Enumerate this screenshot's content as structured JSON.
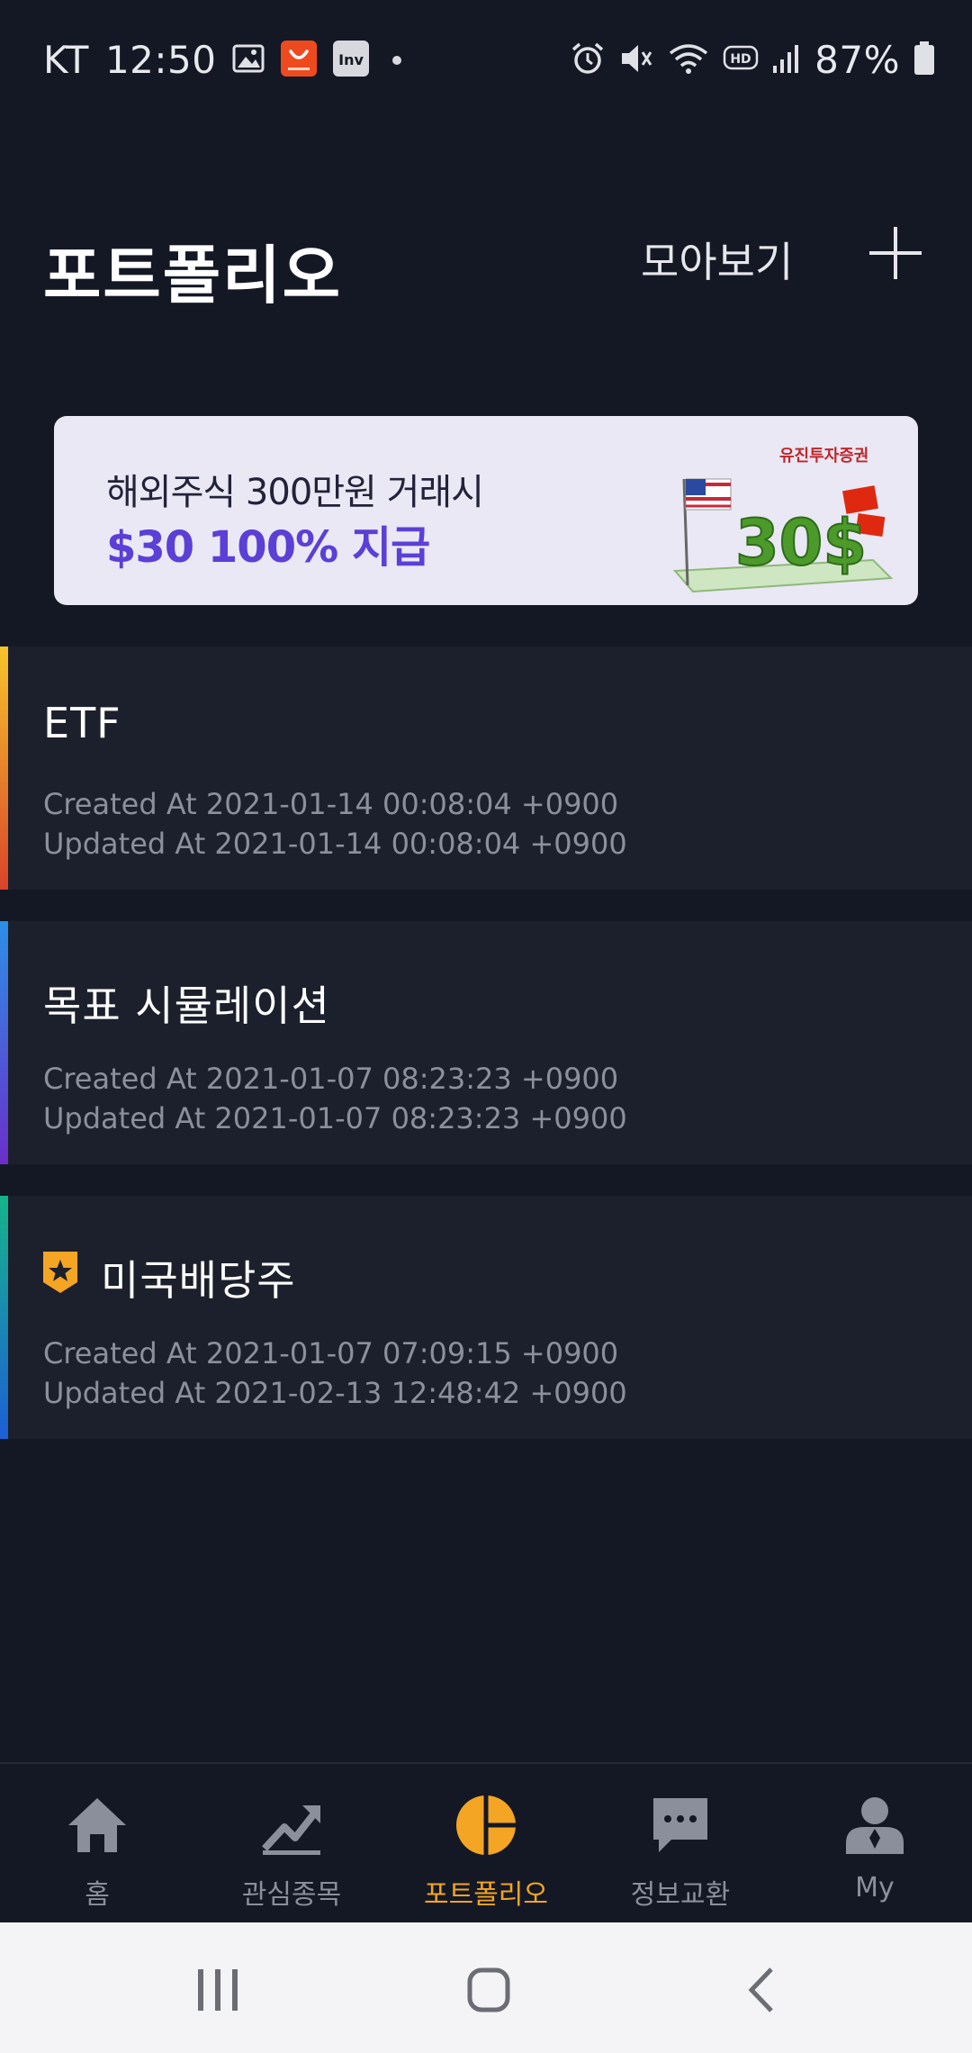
{
  "status_bar": {
    "carrier": "KT",
    "time": "12:50",
    "battery": "87%",
    "icons": [
      "image-icon",
      "aliexpress-icon",
      "investing-icon",
      "alarm-icon",
      "mute-icon",
      "wifi-icon",
      "hd-icon",
      "signal-icon",
      "battery-icon"
    ]
  },
  "header": {
    "title": "포트폴리오",
    "view_all_label": "모아보기",
    "add_icon": "plus-icon"
  },
  "banner": {
    "line1": "해외주식 300만원 거래시",
    "line2": "$30 100% 지급",
    "brand": "유진투자증권",
    "art_text": "30$"
  },
  "portfolios": [
    {
      "name": "ETF",
      "created": "Created At 2021-01-14 00:08:04 +0900",
      "updated": "Updated At 2021-01-14 00:08:04 +0900",
      "accent_colors": [
        "#f7c52c",
        "#d9442a"
      ]
    },
    {
      "name": "목표 시뮬레이션",
      "created": "Created At 2021-01-07 08:23:23 +0900",
      "updated": "Updated At 2021-01-07 08:23:23 +0900",
      "accent_colors": [
        "#2c8fe8",
        "#6a2fc9"
      ]
    },
    {
      "name": "미국배당주",
      "created": "Created At 2021-01-07 07:09:15 +0900",
      "updated": "Updated At 2021-02-13 12:48:42 +0900",
      "accent_colors": [
        "#16b48a",
        "#1d5fd6"
      ],
      "badge_icon": "star-shield-icon"
    }
  ],
  "bottom_nav": [
    {
      "label": "홈",
      "icon": "home-icon",
      "active": false
    },
    {
      "label": "관심종목",
      "icon": "trending-chart-icon",
      "active": false
    },
    {
      "label": "포트폴리오",
      "icon": "pie-chart-icon",
      "active": true
    },
    {
      "label": "정보교환",
      "icon": "chat-bubble-icon",
      "active": false
    },
    {
      "label": "My",
      "icon": "user-icon",
      "active": false
    }
  ],
  "colors": {
    "background": "#141824",
    "card": "#1c202c",
    "active_tab": "#f4a524",
    "inactive_tab": "#8b8f9b",
    "banner_accent": "#5b3fd6"
  }
}
